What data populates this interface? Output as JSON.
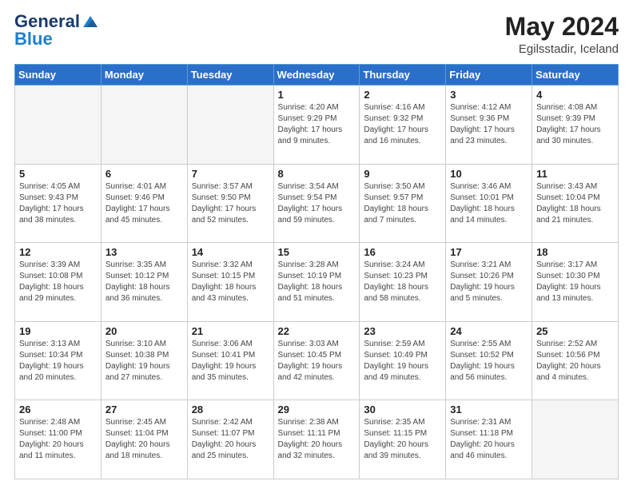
{
  "header": {
    "logo_general": "General",
    "logo_blue": "Blue",
    "month_year": "May 2024",
    "location": "Egilsstadir, Iceland"
  },
  "days_of_week": [
    "Sunday",
    "Monday",
    "Tuesday",
    "Wednesday",
    "Thursday",
    "Friday",
    "Saturday"
  ],
  "weeks": [
    [
      {
        "day": "",
        "info": ""
      },
      {
        "day": "",
        "info": ""
      },
      {
        "day": "",
        "info": ""
      },
      {
        "day": "1",
        "info": "Sunrise: 4:20 AM\nSunset: 9:29 PM\nDaylight: 17 hours\nand 9 minutes."
      },
      {
        "day": "2",
        "info": "Sunrise: 4:16 AM\nSunset: 9:32 PM\nDaylight: 17 hours\nand 16 minutes."
      },
      {
        "day": "3",
        "info": "Sunrise: 4:12 AM\nSunset: 9:36 PM\nDaylight: 17 hours\nand 23 minutes."
      },
      {
        "day": "4",
        "info": "Sunrise: 4:08 AM\nSunset: 9:39 PM\nDaylight: 17 hours\nand 30 minutes."
      }
    ],
    [
      {
        "day": "5",
        "info": "Sunrise: 4:05 AM\nSunset: 9:43 PM\nDaylight: 17 hours\nand 38 minutes."
      },
      {
        "day": "6",
        "info": "Sunrise: 4:01 AM\nSunset: 9:46 PM\nDaylight: 17 hours\nand 45 minutes."
      },
      {
        "day": "7",
        "info": "Sunrise: 3:57 AM\nSunset: 9:50 PM\nDaylight: 17 hours\nand 52 minutes."
      },
      {
        "day": "8",
        "info": "Sunrise: 3:54 AM\nSunset: 9:54 PM\nDaylight: 17 hours\nand 59 minutes."
      },
      {
        "day": "9",
        "info": "Sunrise: 3:50 AM\nSunset: 9:57 PM\nDaylight: 18 hours\nand 7 minutes."
      },
      {
        "day": "10",
        "info": "Sunrise: 3:46 AM\nSunset: 10:01 PM\nDaylight: 18 hours\nand 14 minutes."
      },
      {
        "day": "11",
        "info": "Sunrise: 3:43 AM\nSunset: 10:04 PM\nDaylight: 18 hours\nand 21 minutes."
      }
    ],
    [
      {
        "day": "12",
        "info": "Sunrise: 3:39 AM\nSunset: 10:08 PM\nDaylight: 18 hours\nand 29 minutes."
      },
      {
        "day": "13",
        "info": "Sunrise: 3:35 AM\nSunset: 10:12 PM\nDaylight: 18 hours\nand 36 minutes."
      },
      {
        "day": "14",
        "info": "Sunrise: 3:32 AM\nSunset: 10:15 PM\nDaylight: 18 hours\nand 43 minutes."
      },
      {
        "day": "15",
        "info": "Sunrise: 3:28 AM\nSunset: 10:19 PM\nDaylight: 18 hours\nand 51 minutes."
      },
      {
        "day": "16",
        "info": "Sunrise: 3:24 AM\nSunset: 10:23 PM\nDaylight: 18 hours\nand 58 minutes."
      },
      {
        "day": "17",
        "info": "Sunrise: 3:21 AM\nSunset: 10:26 PM\nDaylight: 19 hours\nand 5 minutes."
      },
      {
        "day": "18",
        "info": "Sunrise: 3:17 AM\nSunset: 10:30 PM\nDaylight: 19 hours\nand 13 minutes."
      }
    ],
    [
      {
        "day": "19",
        "info": "Sunrise: 3:13 AM\nSunset: 10:34 PM\nDaylight: 19 hours\nand 20 minutes."
      },
      {
        "day": "20",
        "info": "Sunrise: 3:10 AM\nSunset: 10:38 PM\nDaylight: 19 hours\nand 27 minutes."
      },
      {
        "day": "21",
        "info": "Sunrise: 3:06 AM\nSunset: 10:41 PM\nDaylight: 19 hours\nand 35 minutes."
      },
      {
        "day": "22",
        "info": "Sunrise: 3:03 AM\nSunset: 10:45 PM\nDaylight: 19 hours\nand 42 minutes."
      },
      {
        "day": "23",
        "info": "Sunrise: 2:59 AM\nSunset: 10:49 PM\nDaylight: 19 hours\nand 49 minutes."
      },
      {
        "day": "24",
        "info": "Sunrise: 2:55 AM\nSunset: 10:52 PM\nDaylight: 19 hours\nand 56 minutes."
      },
      {
        "day": "25",
        "info": "Sunrise: 2:52 AM\nSunset: 10:56 PM\nDaylight: 20 hours\nand 4 minutes."
      }
    ],
    [
      {
        "day": "26",
        "info": "Sunrise: 2:48 AM\nSunset: 11:00 PM\nDaylight: 20 hours\nand 11 minutes."
      },
      {
        "day": "27",
        "info": "Sunrise: 2:45 AM\nSunset: 11:04 PM\nDaylight: 20 hours\nand 18 minutes."
      },
      {
        "day": "28",
        "info": "Sunrise: 2:42 AM\nSunset: 11:07 PM\nDaylight: 20 hours\nand 25 minutes."
      },
      {
        "day": "29",
        "info": "Sunrise: 2:38 AM\nSunset: 11:11 PM\nDaylight: 20 hours\nand 32 minutes."
      },
      {
        "day": "30",
        "info": "Sunrise: 2:35 AM\nSunset: 11:15 PM\nDaylight: 20 hours\nand 39 minutes."
      },
      {
        "day": "31",
        "info": "Sunrise: 2:31 AM\nSunset: 11:18 PM\nDaylight: 20 hours\nand 46 minutes."
      },
      {
        "day": "",
        "info": ""
      }
    ]
  ]
}
